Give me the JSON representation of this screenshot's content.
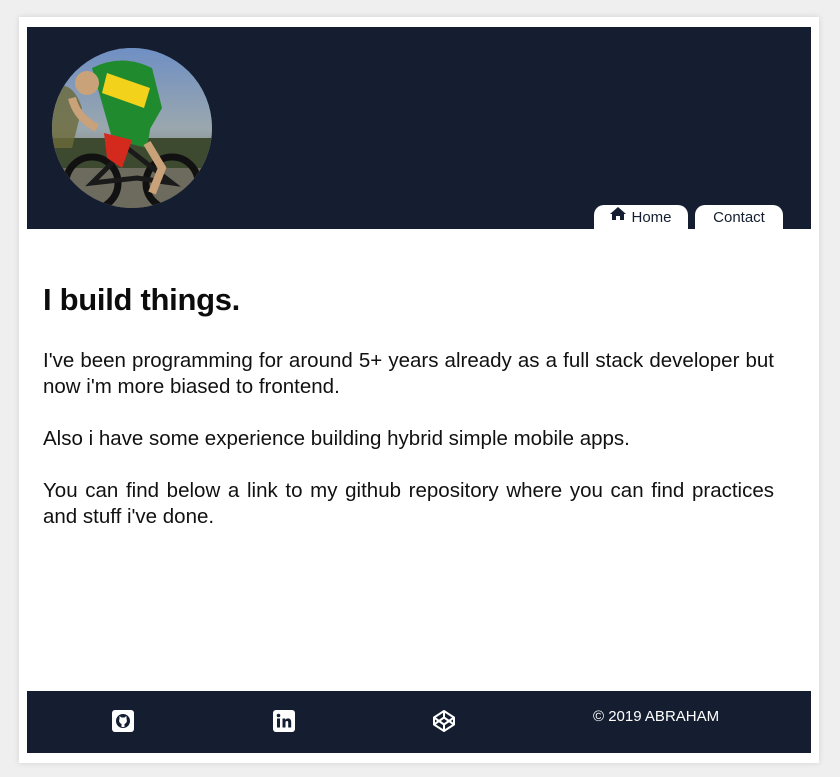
{
  "header": {
    "avatar_alt": "profile photo of cyclist",
    "nav": {
      "home_label": "Home",
      "contact_label": "Contact"
    }
  },
  "main": {
    "headline": "I build things.",
    "paragraphs": [
      "I've been programming for around 5+ years already as a full stack developer but now i'm more biased to frontend.",
      "Also i have some experience building hybrid simple mobile apps.",
      "You can find below a link to my github repository where you can find practices and stuff i've done."
    ]
  },
  "footer": {
    "icons": [
      "github-icon",
      "linkedin-icon",
      "codepen-icon"
    ],
    "copyright": "© 2019 ABRAHAM"
  },
  "colors": {
    "header_bg": "#151e31",
    "page_bg": "#efefef",
    "card_bg": "#ffffff"
  }
}
